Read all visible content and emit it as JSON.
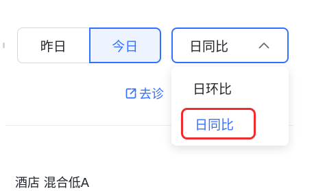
{
  "period_toggle": {
    "yesterday_label": "昨日",
    "today_label": "今日",
    "selected": "今日"
  },
  "compare_select": {
    "value": "日同比",
    "expanded": true,
    "options": [
      "日环比",
      "日同比"
    ],
    "selected_option": "日同比",
    "icon": "chevron-up-icon"
  },
  "diagnose_link": {
    "label": "去诊",
    "icon": "external-link-icon"
  },
  "bottom_text": "酒店 混合低A",
  "colors": {
    "accent": "#3370ff",
    "accent_bg": "#eef4ff",
    "highlight_box": "#ef2b2b",
    "text": "#1f2329",
    "border": "#d4d7de"
  }
}
